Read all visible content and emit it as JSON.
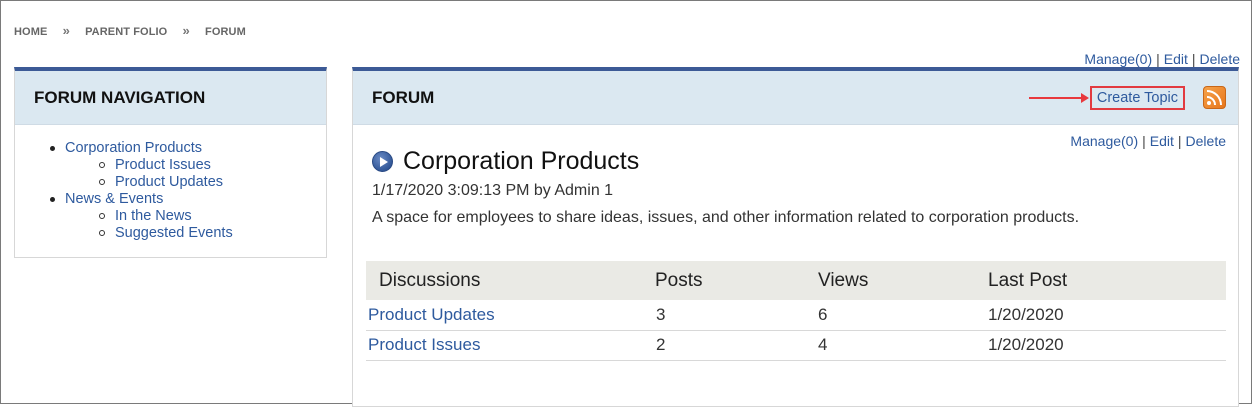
{
  "breadcrumb": [
    "HOME",
    "PARENT FOLIO",
    "FORUM"
  ],
  "breadcrumb_separator": "»",
  "page_actions": {
    "manage": "Manage(0)",
    "edit": "Edit",
    "delete": "Delete",
    "separator": "|"
  },
  "nav_panel": {
    "title": "FORUM NAVIGATION",
    "items": [
      {
        "label": "Corporation Products",
        "children": [
          "Product Issues",
          "Product Updates"
        ]
      },
      {
        "label": "News & Events",
        "children": [
          "In the News",
          "Suggested Events"
        ]
      }
    ]
  },
  "forum_panel": {
    "title": "FORUM",
    "create_topic_label": "Create Topic",
    "rss_icon": "rss-feed-icon",
    "actions": {
      "manage": "Manage(0)",
      "edit": "Edit",
      "delete": "Delete",
      "separator": "|"
    },
    "forum": {
      "name": "Corporation Products",
      "meta": "1/17/2020 3:09:13 PM by Admin 1",
      "description": "A space for employees to share ideas, issues, and other information related to corporation products."
    },
    "table": {
      "headers": [
        "Discussions",
        "Posts",
        "Views",
        "Last Post"
      ],
      "rows": [
        {
          "discussion": "Product Updates",
          "posts": "3",
          "views": "6",
          "last_post": "1/20/2020"
        },
        {
          "discussion": "Product Issues",
          "posts": "2",
          "views": "4",
          "last_post": "1/20/2020"
        }
      ]
    }
  },
  "colors": {
    "accent": "#3c5a96",
    "header_bg": "#dbe8f1",
    "link": "#2e5a9e",
    "highlight": "#e23a40"
  }
}
